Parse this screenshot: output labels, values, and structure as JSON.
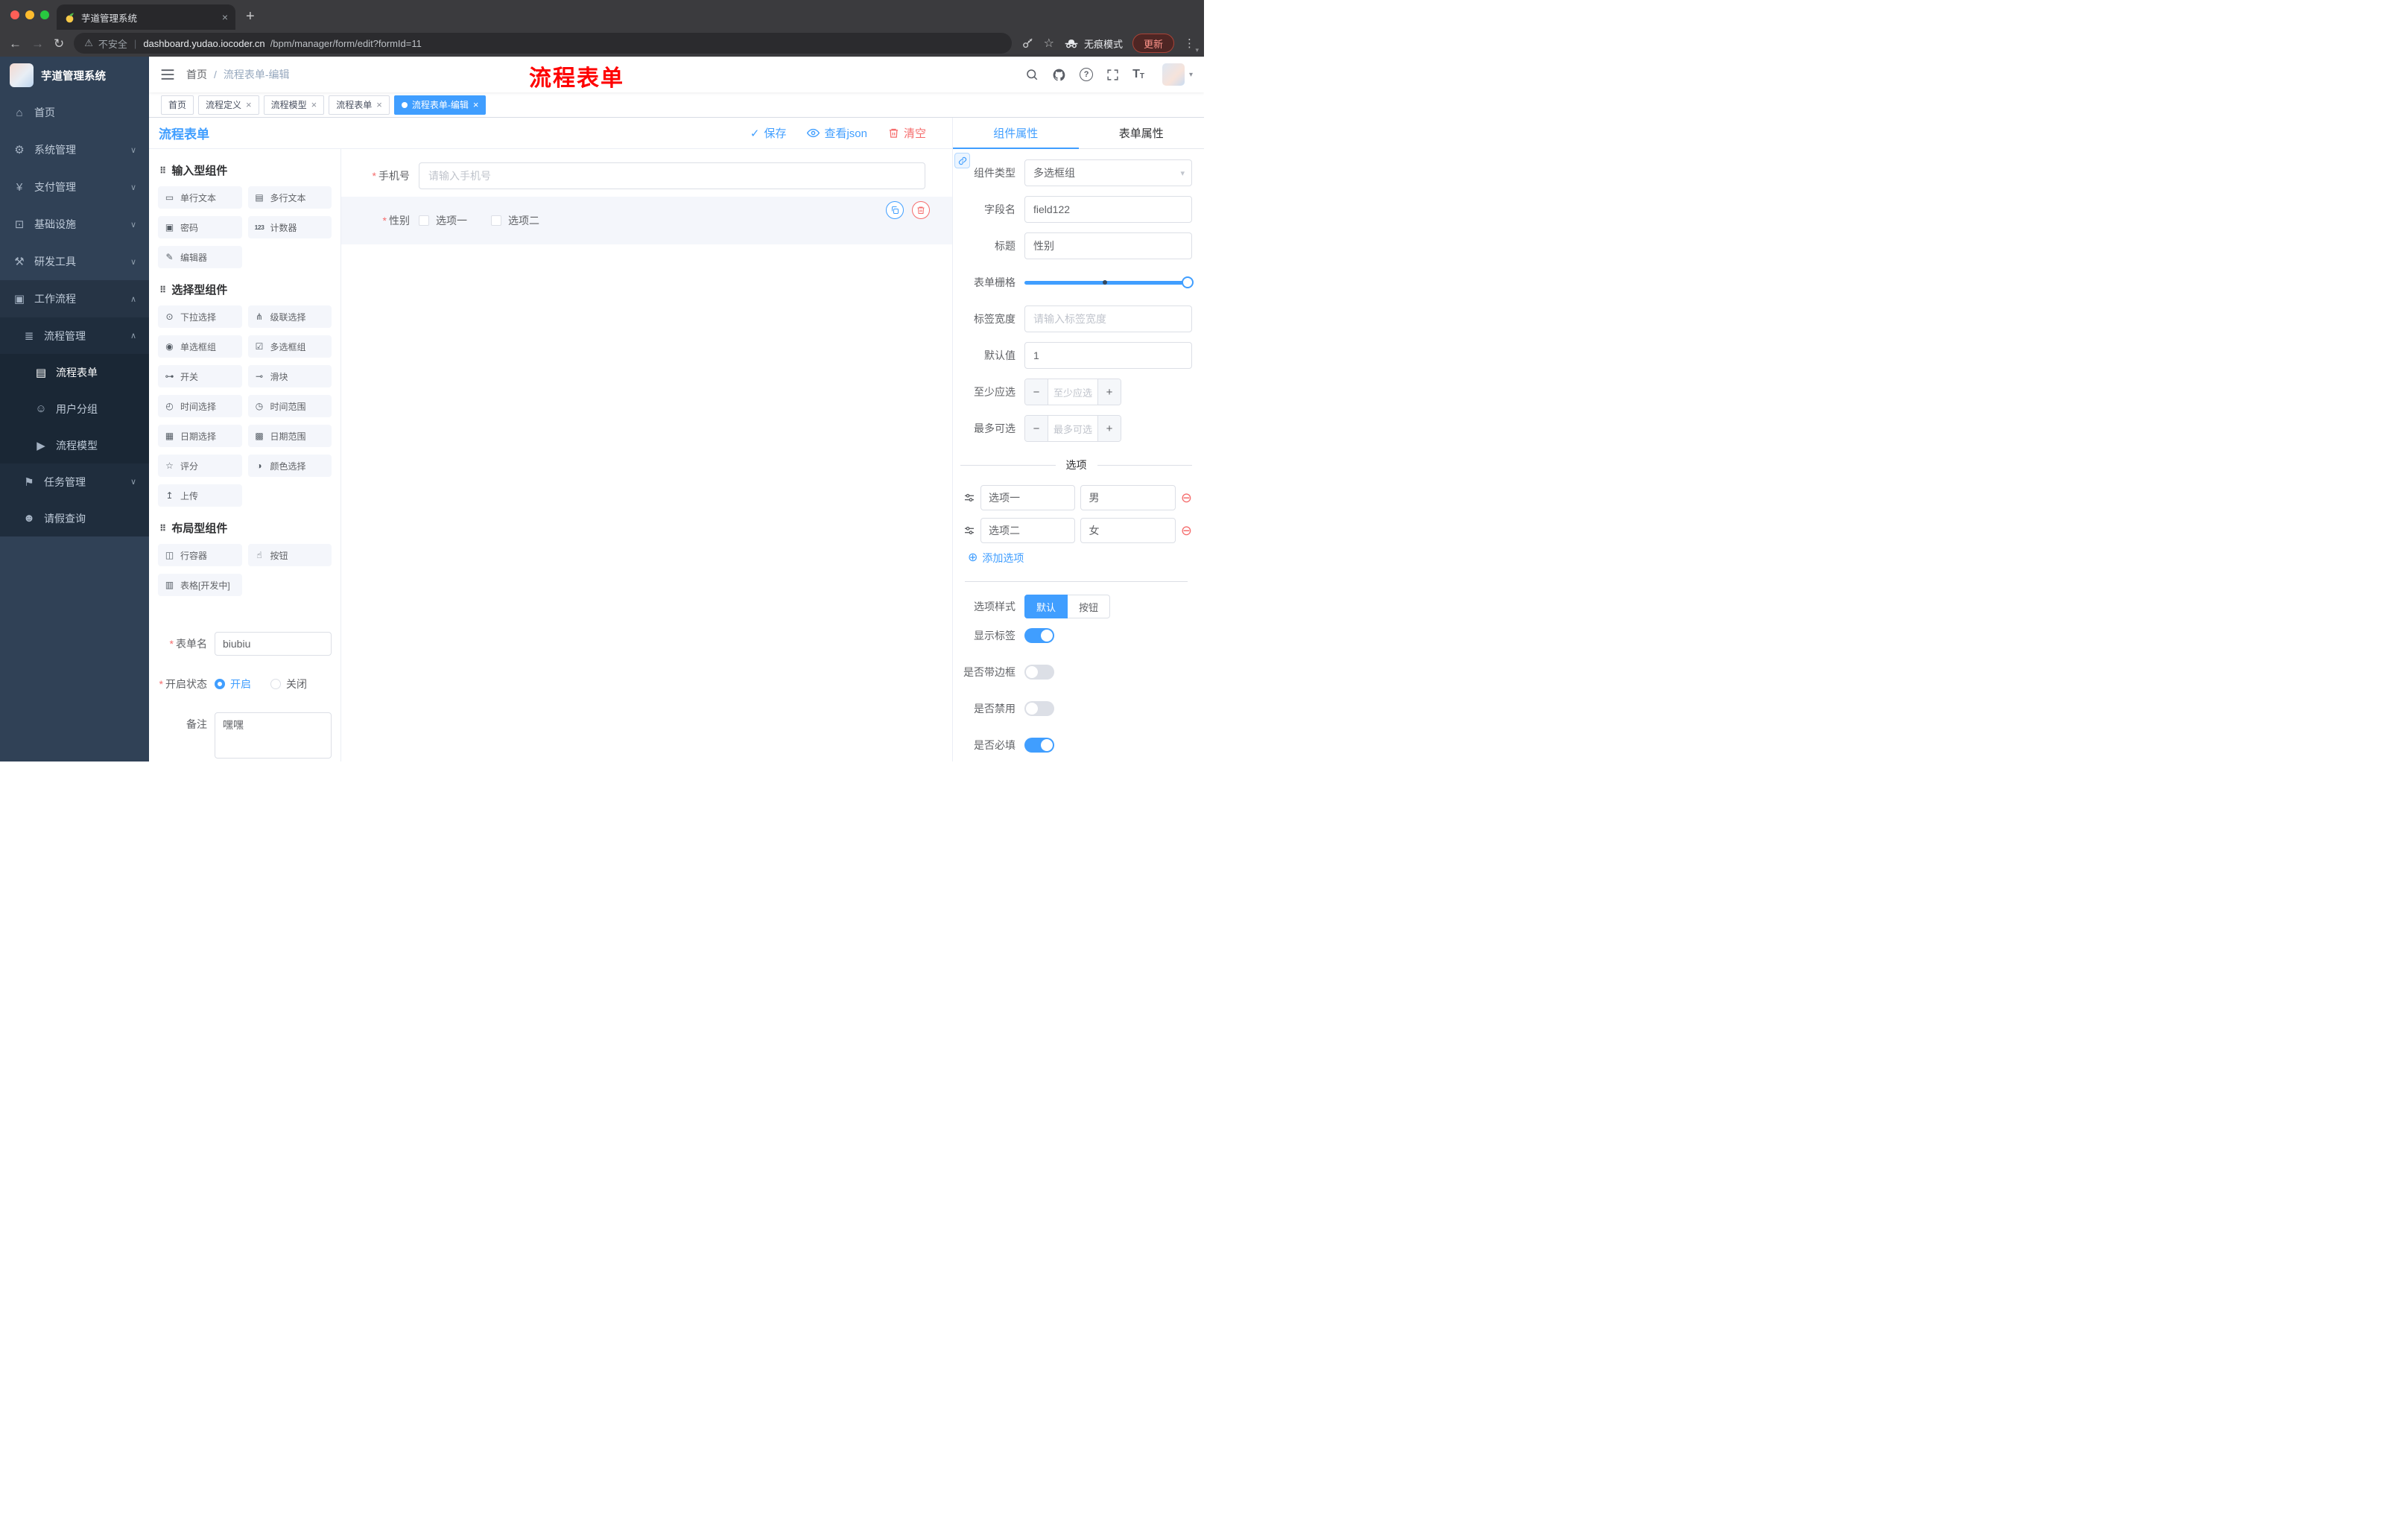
{
  "theme": {
    "accent": "#409eff",
    "danger": "#f56c6c",
    "sidebar_bg": "#304156",
    "annotation_red": "#fe0000",
    "active_tag_bg": "#409eff"
  },
  "icons": {
    "home": "⌂",
    "system": "⚙",
    "payment": "¥",
    "infra": "⊡",
    "devtools": "⚒",
    "workflow": "▣",
    "process": "≣",
    "form": "▤",
    "users": "☺",
    "model": "▶",
    "task": "⚑",
    "person": "☻",
    "chevron_down": "∨",
    "chevron_up": "∧",
    "close": "×",
    "plus": "+",
    "back": "←",
    "forward": "→",
    "reload": "↻",
    "warning": "⚠",
    "star": "☆",
    "dots": "⋮",
    "caret": "▾",
    "check": "✓",
    "drag": "⠿",
    "question": "?",
    "required_mark": "*",
    "minus_circle": "⊖",
    "plus_circle": "⊕",
    "stepper_minus": "−",
    "stepper_plus": "+",
    "font_large": "T",
    "font_small": "T",
    "chip_single": "▭",
    "chip_multi": "▤",
    "chip_password": "▣",
    "chip_counter": "123",
    "chip_editor": "✎",
    "chip_select": "⊙",
    "chip_cascader": "⋔",
    "chip_radio": "◉",
    "chip_checkbox": "☑",
    "chip_switch": "⊶",
    "chip_slider": "⊸",
    "chip_time": "◴",
    "chip_timerange": "◷",
    "chip_date": "▦",
    "chip_daterange": "▩",
    "chip_rate": "☆",
    "chip_color": "◑",
    "chip_upload": "↥",
    "chip_row": "◫",
    "chip_button": "☝",
    "chip_table": "▥"
  },
  "browser": {
    "tab_title": "芋道管理系统",
    "security": "不安全",
    "url_domain": "dashboard.yudao.iocoder.cn",
    "url_path": "/bpm/manager/form/edit?formId=11",
    "incognito": "无痕模式",
    "update": "更新"
  },
  "sidebar": {
    "title": "芋道管理系统",
    "home": "首页",
    "system": "系统管理",
    "payment": "支付管理",
    "infra": "基础设施",
    "devtools": "研发工具",
    "workflow": "工作流程",
    "process_mgmt": "流程管理",
    "process_form": "流程表单",
    "user_group": "用户分组",
    "process_model": "流程模型",
    "task_mgmt": "任务管理",
    "leave_query": "请假查询"
  },
  "header": {
    "breadcrumb_home": "首页",
    "breadcrumb_sep": "/",
    "breadcrumb_current": "流程表单-编辑",
    "annotation": "流程表单"
  },
  "tags": {
    "home": "首页",
    "t1": "流程定义",
    "t2": "流程模型",
    "t3": "流程表单",
    "active": "流程表单-编辑"
  },
  "designer": {
    "title": "流程表单",
    "save": "保存",
    "view_json": "查看json",
    "clear": "清空",
    "sections": {
      "input": {
        "title": "输入型组件",
        "items": [
          "单行文本",
          "多行文本",
          "密码",
          "计数器",
          "编辑器"
        ]
      },
      "select": {
        "title": "选择型组件",
        "items": [
          "下拉选择",
          "级联选择",
          "单选框组",
          "多选框组",
          "开关",
          "滑块",
          "时间选择",
          "时间范围",
          "日期选择",
          "日期范围",
          "评分",
          "颜色选择",
          "上传"
        ]
      },
      "layout": {
        "title": "布局型组件",
        "items": [
          "行容器",
          "按钮",
          "表格[开发中]"
        ]
      }
    },
    "meta": {
      "name_label": "表单名",
      "name_value": "biubiu",
      "status_label": "开启状态",
      "status_on": "开启",
      "status_off": "关闭",
      "remark_label": "备注",
      "remark_value": "嘿嘿"
    },
    "canvas": {
      "phone_label": "手机号",
      "phone_placeholder": "请输入手机号",
      "gender_label": "性别",
      "gender_opt1": "选项一",
      "gender_opt2": "选项二"
    }
  },
  "props": {
    "tab_component": "组件属性",
    "tab_form": "表单属性",
    "type_label": "组件类型",
    "type_value": "多选框组",
    "field_label": "字段名",
    "field_value": "field122",
    "title_label": "标题",
    "title_value": "性别",
    "grid_label": "表单栅格",
    "labelwidth_label": "标签宽度",
    "labelwidth_placeholder": "请输入标签宽度",
    "default_label": "默认值",
    "default_value": "1",
    "min_label": "至少应选",
    "min_placeholder": "至少应选",
    "max_label": "最多可选",
    "max_placeholder": "最多可选",
    "options_title": "选项",
    "option1_label": "选项一",
    "option1_value": "男",
    "option2_label": "选项二",
    "option2_value": "女",
    "add_option": "添加选项",
    "style_label": "选项样式",
    "style_default": "默认",
    "style_button": "按钮",
    "show_label": "显示标签",
    "border_label": "是否带边框",
    "disabled_label": "是否禁用",
    "required_label": "是否必填"
  }
}
